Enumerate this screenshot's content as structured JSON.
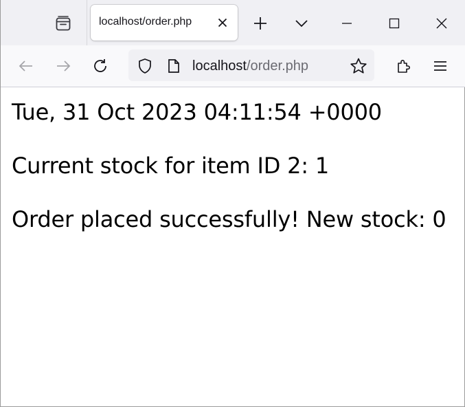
{
  "browser": {
    "tab": {
      "title": "localhost/order.php"
    },
    "url": {
      "host": "localhost",
      "path": "/order.php"
    }
  },
  "page": {
    "lines": [
      "Tue, 31 Oct 2023 04:11:54 +0000",
      "Current stock for item ID 2: 1",
      "Order placed successfully! New stock: 0"
    ]
  }
}
